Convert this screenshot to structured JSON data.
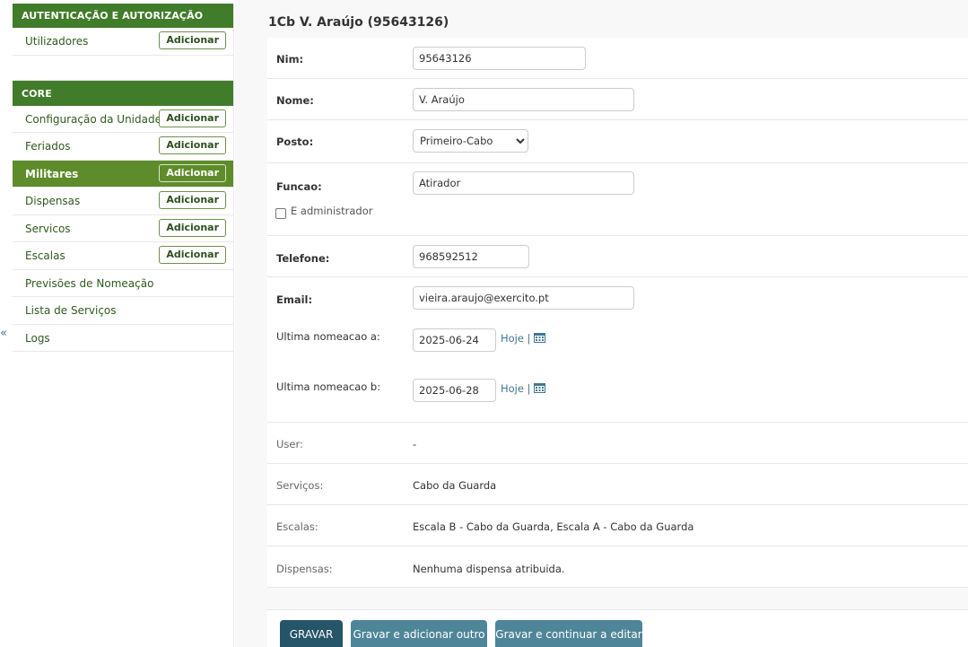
{
  "sidebar": {
    "collapse_glyph": "«",
    "modules": [
      {
        "caption": "AUTENTICAÇÃO E AUTORIZAÇÃO",
        "items": [
          {
            "label": "Utilizadores",
            "add_label": "Adicionar"
          }
        ]
      },
      {
        "caption": "CORE",
        "items": [
          {
            "label": "Configuração da Unidade",
            "add_label": "Adicionar"
          },
          {
            "label": "Feriados",
            "add_label": "Adicionar"
          },
          {
            "label": "Militares",
            "add_label": "Adicionar",
            "active": true
          },
          {
            "label": "Dispensas",
            "add_label": "Adicionar"
          },
          {
            "label": "Servicos",
            "add_label": "Adicionar"
          },
          {
            "label": "Escalas",
            "add_label": "Adicionar"
          },
          {
            "label": "Previsões de Nomeação"
          },
          {
            "label": "Lista de Serviços"
          },
          {
            "label": "Logs"
          }
        ]
      }
    ]
  },
  "page": {
    "title": "1Cb V. Araújo (95643126)"
  },
  "form": {
    "nim": {
      "label": "Nim:",
      "value": "95643126"
    },
    "nome": {
      "label": "Nome:",
      "value": "V. Araújo"
    },
    "posto": {
      "label": "Posto:",
      "value": "Primeiro-Cabo"
    },
    "funcao": {
      "label": "Funcao:",
      "value": "Atirador"
    },
    "admin": {
      "label": "E administrador",
      "checked": false
    },
    "telefone": {
      "label": "Telefone:",
      "value": "968592512"
    },
    "email": {
      "label": "Email:",
      "value": "vieira.araujo@exercito.pt"
    },
    "ultima_a": {
      "label": "Ultima nomeacao a:",
      "value": "2025-06-24",
      "today": "Hoje",
      "sep": "|"
    },
    "ultima_b": {
      "label": "Ultima nomeacao b:",
      "value": "2025-06-28",
      "today": "Hoje",
      "sep": "|"
    },
    "user": {
      "label": "User:",
      "value": "-"
    },
    "servicos": {
      "label": "Serviços:",
      "value": "Cabo da Guarda"
    },
    "escalas": {
      "label": "Escalas:",
      "value": "Escala B - Cabo da Guarda, Escala A - Cabo da Guarda"
    },
    "dispensas": {
      "label": "Dispensas:",
      "value": "Nenhuma dispensa atribuida."
    }
  },
  "submit": {
    "save": "GRAVAR",
    "save_add": "Gravar e adicionar outro",
    "save_continue": "Gravar e continuar a editar"
  },
  "colors": {
    "module_header": "#417c2a",
    "active_row": "#5f8c2a",
    "link": "#417690",
    "primary_button": "#265468",
    "secondary_button": "#4f8599"
  },
  "icons": {
    "calendar": "calendar-icon",
    "collapse": "collapse-sidebar-icon"
  }
}
